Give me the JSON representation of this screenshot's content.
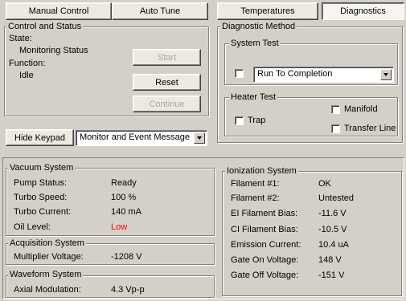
{
  "tabs_left": {
    "manual": "Manual Control",
    "auto": "Auto Tune"
  },
  "tabs_right": {
    "temperatures": "Temperatures",
    "diagnostics": "Diagnostics"
  },
  "control": {
    "legend": "Control and Status",
    "state_label": "State:",
    "state_value": "Monitoring Status",
    "function_label": "Function:",
    "function_value": "Idle",
    "start": "Start",
    "reset": "Reset",
    "continue": "Continue"
  },
  "keypad": {
    "hide": "Hide Keypad",
    "mode_value": "Monitor and Event Message"
  },
  "diag": {
    "legend": "Diagnostic Method",
    "system_test_legend": "System Test",
    "system_test_value": "Run To Completion",
    "heater_legend": "Heater Test",
    "trap": "Trap",
    "manifold": "Manifold",
    "transfer": "Transfer Line"
  },
  "vacuum": {
    "legend": "Vacuum System",
    "rows": [
      {
        "label": "Pump Status:",
        "value": "Ready"
      },
      {
        "label": "Turbo Speed:",
        "value": "100 %"
      },
      {
        "label": "Turbo Current:",
        "value": "140 mA"
      },
      {
        "label": "Oil Level:",
        "value": "Low"
      }
    ]
  },
  "acquisition": {
    "legend": "Acquisition System",
    "rows": [
      {
        "label": "Multiplier Voltage:",
        "value": "-1208 V"
      }
    ]
  },
  "waveform": {
    "legend": "Waveform System",
    "rows": [
      {
        "label": "Axial Modulation:",
        "value": "4.3 Vp-p"
      }
    ]
  },
  "ionization": {
    "legend": "Ionization System",
    "rows": [
      {
        "label": "Filament #1:",
        "value": "OK"
      },
      {
        "label": "Filament #2:",
        "value": "Untested"
      },
      {
        "label": "EI Filament Bias:",
        "value": "-11.6 V"
      },
      {
        "label": "CI Filament Bias:",
        "value": "-10.5 V"
      },
      {
        "label": "Emission Current:",
        "value": "10.4 uA"
      },
      {
        "label": "Gate On Voltage:",
        "value": "148 V"
      },
      {
        "label": "Gate Off Voltage:",
        "value": "-151 V"
      }
    ]
  },
  "colors": {
    "alert": "#ff0000",
    "face": "#d4d0c8"
  }
}
